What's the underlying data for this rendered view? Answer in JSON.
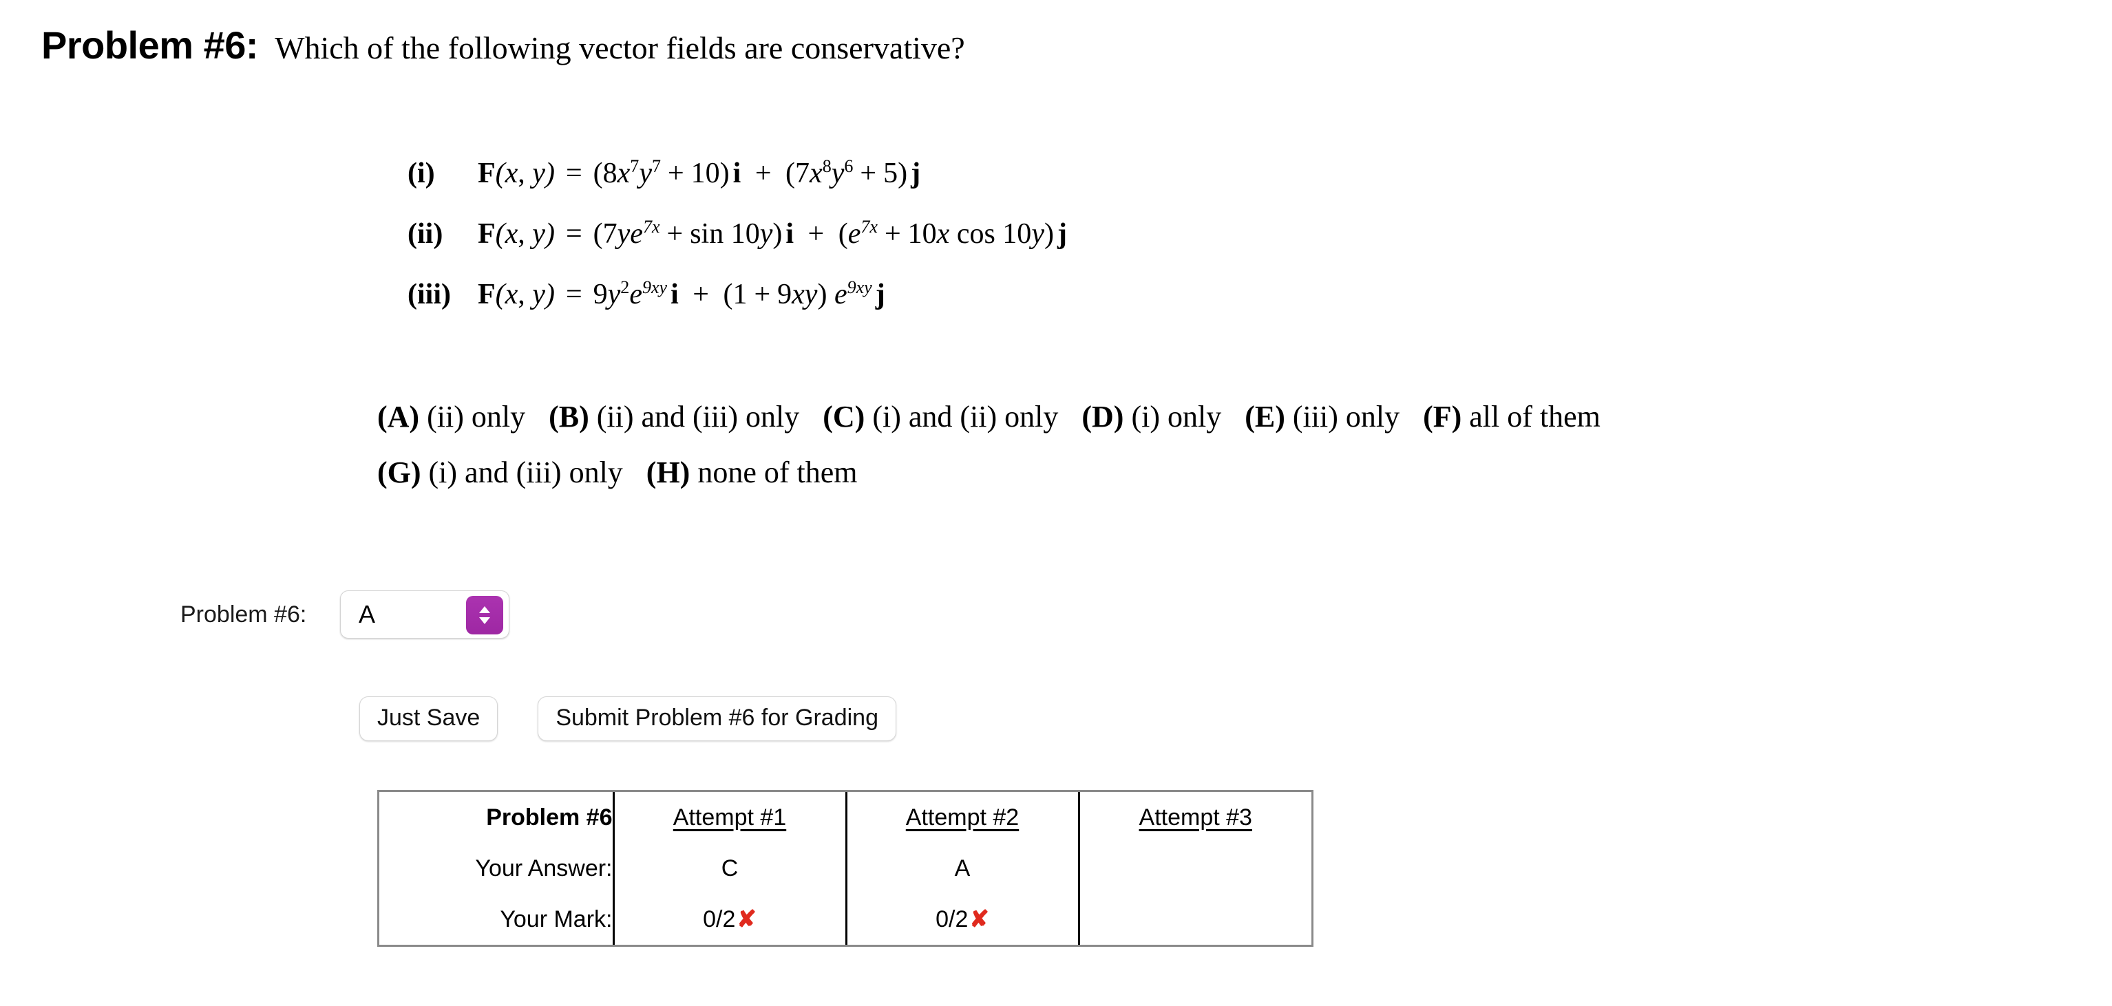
{
  "header": {
    "problem_label": "Problem #6:",
    "question": "Which of the following vector fields are conservative?"
  },
  "math": {
    "items": [
      {
        "tag": "(i)",
        "function": "F(x, y)",
        "equals": "=",
        "expression": "(8x⁷y⁷ + 10) i  +  (7x⁸y⁶ + 5) j"
      },
      {
        "tag": "(ii)",
        "function": "F(x, y)",
        "equals": "=",
        "expression": "(7ye⁷ˣ + sin 10y) i  +  (e⁷ˣ + 10x cos 10y) j"
      },
      {
        "tag": "(iii)",
        "function": "F(x, y)",
        "equals": "=",
        "expression": "9y²e⁹ˣʸ i  +  (1 + 9xy) e⁹ˣʸ j"
      }
    ]
  },
  "options": {
    "row1": [
      {
        "letter": "(A)",
        "text": "(ii) only"
      },
      {
        "letter": "(B)",
        "text": "(ii) and (iii) only"
      },
      {
        "letter": "(C)",
        "text": "(i) and (ii) only"
      },
      {
        "letter": "(D)",
        "text": "(i) only"
      },
      {
        "letter": "(E)",
        "text": "(iii) only"
      },
      {
        "letter": "(F)",
        "text": "all of them"
      }
    ],
    "row2": [
      {
        "letter": "(G)",
        "text": "(i) and (iii) only"
      },
      {
        "letter": "(H)",
        "text": "none of them"
      }
    ]
  },
  "answer": {
    "label": "Problem #6:",
    "selected_value": "A",
    "stepper_icon": "chevron-up-down-icon",
    "stepper_color": "#a32ba8"
  },
  "buttons": {
    "just_save": "Just Save",
    "submit": "Submit Problem #6 for Grading"
  },
  "results": {
    "header": {
      "title": "Problem #6",
      "attempts": [
        "Attempt #1",
        "Attempt #2",
        "Attempt #3"
      ]
    },
    "rows": [
      {
        "label": "Your Answer:",
        "values": [
          "C",
          "A",
          ""
        ]
      },
      {
        "label": "Your Mark:",
        "values": [
          "0/2",
          "0/2",
          ""
        ],
        "marks": [
          "✘",
          "✘",
          ""
        ]
      }
    ],
    "wrong_color": "#e02a1e",
    "border_color": "#8a8a8a"
  }
}
